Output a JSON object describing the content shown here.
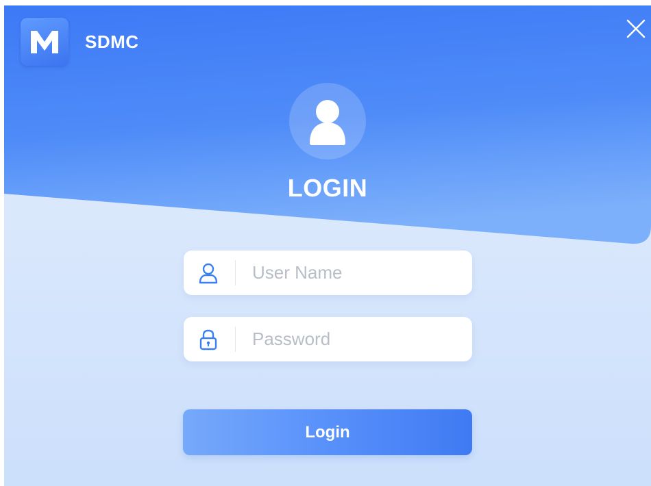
{
  "app": {
    "name": "SDMC",
    "logo_letter": "M"
  },
  "heading": "LOGIN",
  "username": {
    "value": "",
    "placeholder": "User Name",
    "icon": "user-outline-icon"
  },
  "password": {
    "value": "",
    "placeholder": "Password",
    "icon": "lock-icon"
  },
  "buttons": {
    "login_label": "Login",
    "close_icon": "close-icon"
  },
  "colors": {
    "header_blue_top": "#3f7bf6",
    "header_blue_bottom": "#73a9fb",
    "background": "#dce8fc",
    "icon_blue": "#3b80f0",
    "accent": "#3f7af3"
  }
}
